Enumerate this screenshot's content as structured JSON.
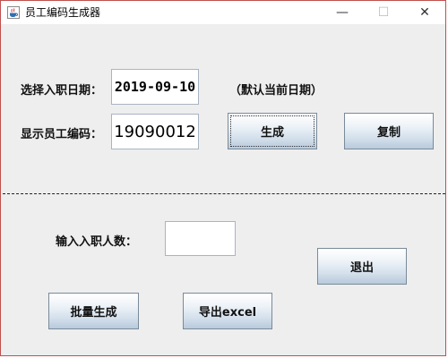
{
  "window": {
    "title": "员工编码生成器",
    "minimize_glyph": "—",
    "maximize_glyph": "☐",
    "close_glyph": "✕",
    "icon": "java-cup-icon"
  },
  "single": {
    "date_label": "选择入职日期：",
    "date_value": "2019-09-10",
    "default_hint": "（默认当前日期）",
    "code_label": "显示员工编码：",
    "code_value": "19090012",
    "generate_label": "生成",
    "copy_label": "复制"
  },
  "batch": {
    "count_label": "输入入职人数：",
    "count_value": "",
    "exit_label": "退出",
    "batch_generate_label": "批量生成",
    "export_label": "导出excel"
  },
  "colors": {
    "window_border": "#c0504d",
    "panel_background": "#eeeeee",
    "button_gradient_bottom": "#b8cadc"
  }
}
